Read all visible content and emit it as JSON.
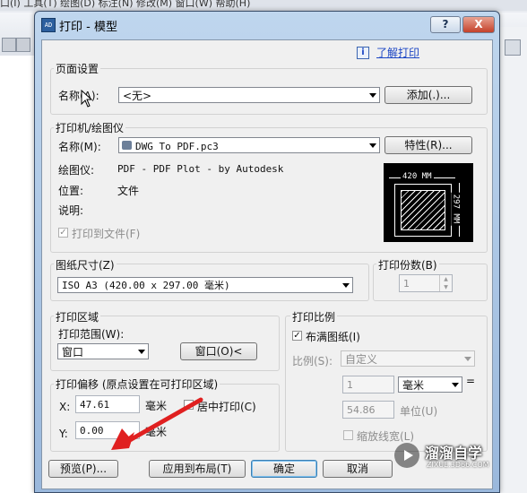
{
  "background": {
    "menu_text": "口(I)   工具(T)   绘图(D)   标注(N)   修改(M)   窗口(W)   帮助(H)"
  },
  "dialog": {
    "title": "打印 - 模型",
    "help_button": "?",
    "close_button": "X",
    "learn_link": "了解打印",
    "page_setup": {
      "group_label": "页面设置",
      "name_label": "名称(A):",
      "name_value": "<无>",
      "add_button": "添加(.)..."
    },
    "printer": {
      "group_label": "打印机/绘图仪",
      "name_label": "名称(M):",
      "name_value": "DWG To PDF.pc3",
      "properties_button": "特性(R)...",
      "plotter_label": "绘图仪:",
      "plotter_value": "PDF - PDF Plot - by Autodesk",
      "location_label": "位置:",
      "location_value": "文件",
      "description_label": "说明:",
      "print_to_file_label": "打印到文件(F)",
      "print_to_file_checked": true,
      "preview_width_label": "420 MM",
      "preview_height_label": "297 MM"
    },
    "paper_size": {
      "group_label": "图纸尺寸(Z)",
      "value": "ISO A3 (420.00 x 297.00 毫米)"
    },
    "copies": {
      "group_label": "打印份数(B)",
      "value": "1"
    },
    "plot_area": {
      "group_label": "打印区域",
      "range_label": "打印范围(W):",
      "range_value": "窗口",
      "window_button": "窗口(O)<"
    },
    "plot_offset": {
      "group_label": "打印偏移 (原点设置在可打印区域)",
      "x_label": "X:",
      "x_value": "47.61",
      "x_unit": "毫米",
      "y_label": "Y:",
      "y_value": "0.00",
      "y_unit": "毫米",
      "center_label": "居中打印(C)",
      "center_checked": false
    },
    "plot_scale": {
      "group_label": "打印比例",
      "fit_label": "布满图纸(I)",
      "fit_checked": true,
      "scale_label": "比例(S):",
      "scale_value": "自定义",
      "value1": "1",
      "unit_value": "毫米",
      "equals": "=",
      "value2": "54.86",
      "unit_label": "单位(U)",
      "lineweight_label": "缩放线宽(L)"
    },
    "footer": {
      "preview_button": "预览(P)...",
      "apply_button": "应用到布局(T)",
      "ok_button": "确定",
      "cancel_button": "取消"
    }
  },
  "watermark": {
    "brand": "溜溜自学",
    "url": "ZIXUE.3D66.COM"
  },
  "colors": {
    "accent_red": "#e02020",
    "link_blue": "#1c46c4",
    "titlebar": "#a9c4e4"
  }
}
